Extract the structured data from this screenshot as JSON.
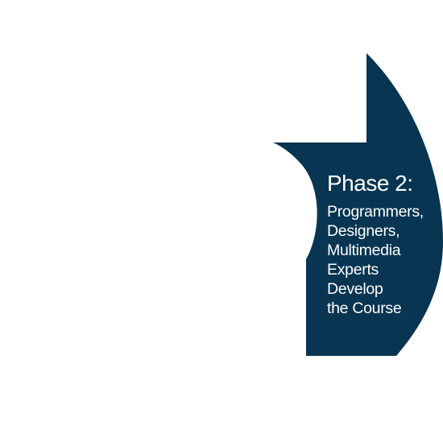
{
  "colors": {
    "background": "#ffffff",
    "segment_fill": "#073552",
    "text": "#ffffff"
  },
  "phase": {
    "title": "Phase 2:",
    "lines": [
      "Programmers,",
      "Designers,",
      "Multimedia",
      "Experts",
      "Develop",
      "the Course"
    ]
  }
}
